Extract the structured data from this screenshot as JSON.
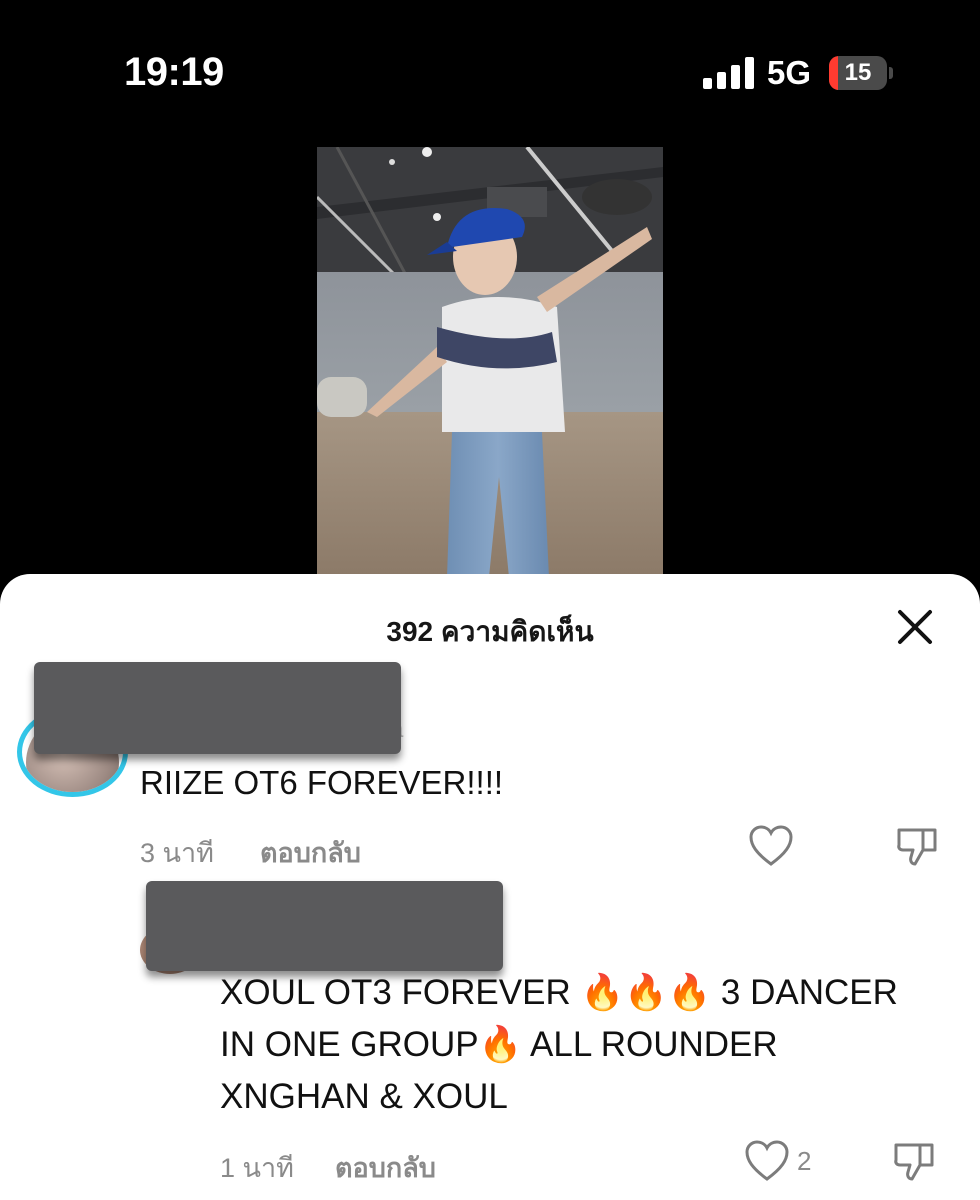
{
  "status_bar": {
    "time": "19:19",
    "network": "5G",
    "battery": "15",
    "battery_level_percent": 15,
    "signal_bars": 4,
    "battery_fill_color": "#ff3b30"
  },
  "video": {
    "description_icon": "video-thumbnail"
  },
  "comments_sheet": {
    "title": "392 ความคิดเห็น",
    "close_icon": "close-icon",
    "comments": [
      {
        "text": "RIIZE OT6 FOREVER!!!!",
        "time": "3 นาที",
        "reply_label": "ตอบกลับ",
        "like_count": "",
        "username_hidden_fragment": "a"
      },
      {
        "text_lines": [
          "XOUL OT3 FOREVER 🔥🔥🔥 3 DANCER",
          "IN ONE GROUP🔥 ALL ROUNDER",
          "XNGHAN & XOUL"
        ],
        "time": "1 นาที",
        "reply_label": "ตอบกลับ",
        "like_count": "2"
      }
    ]
  },
  "colors": {
    "accent_ring": "#33c6e8",
    "muted_text": "#8a8a8a",
    "redaction": "#5a5a5c"
  }
}
